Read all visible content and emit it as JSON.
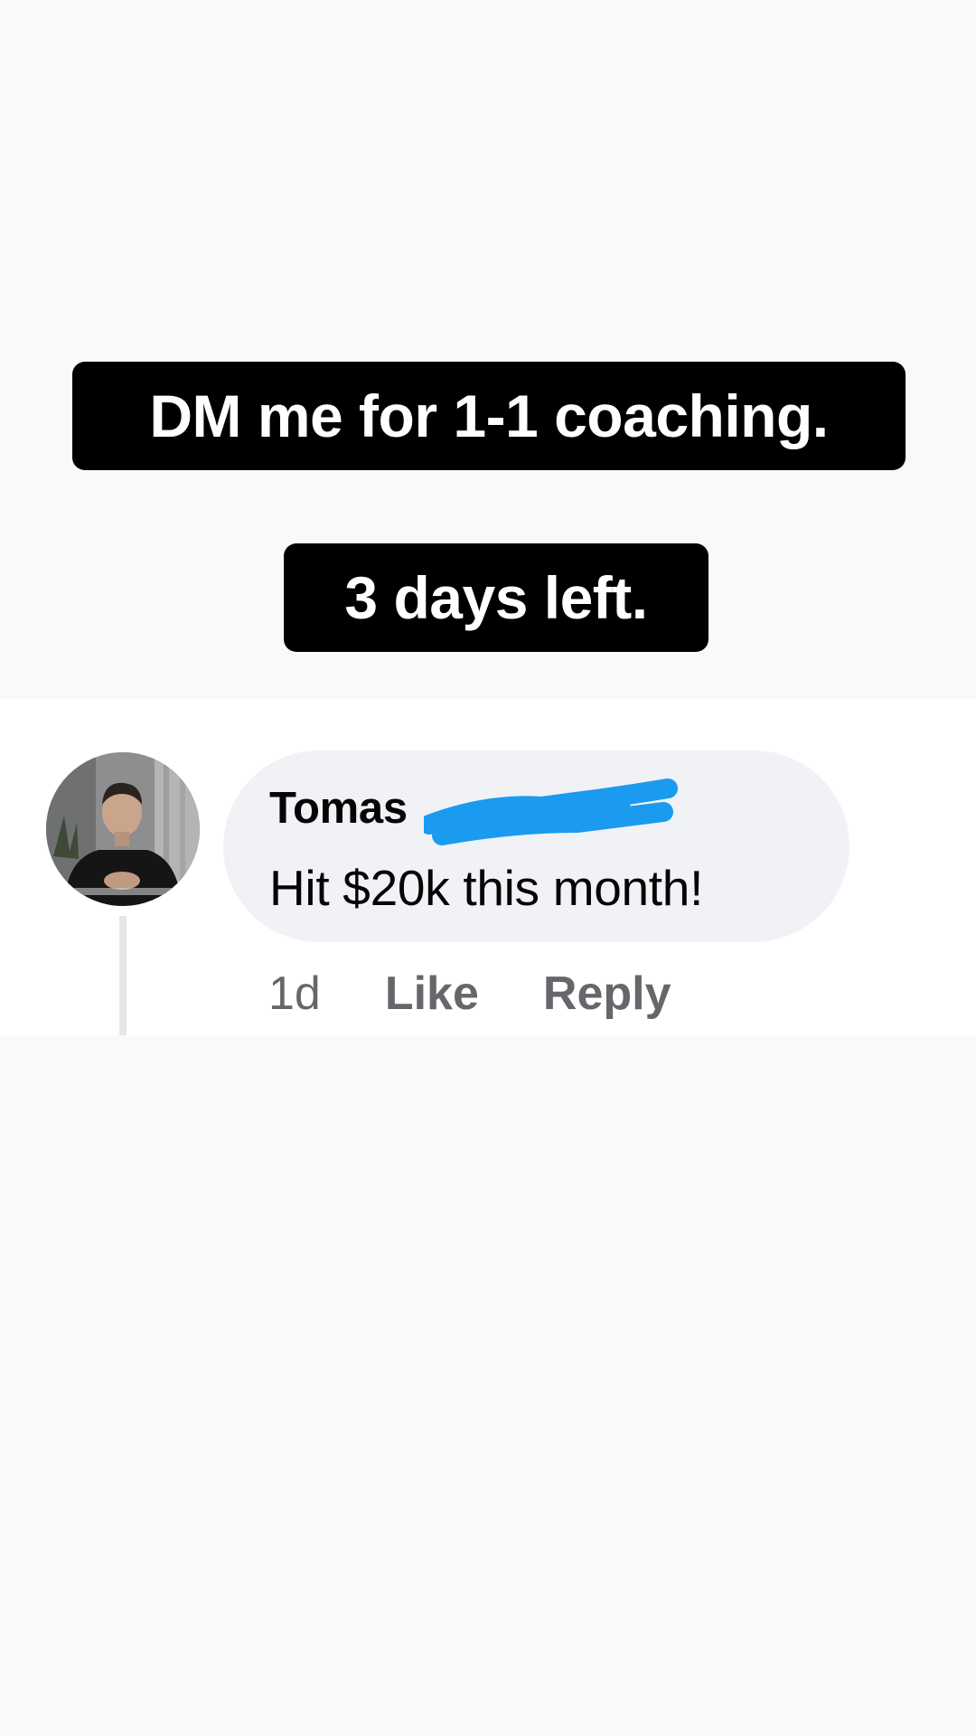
{
  "story": {
    "caption_line_1": "DM me for 1-1 coaching.",
    "caption_line_2": "3 days left."
  },
  "comment": {
    "author_name": "Tomas",
    "author_name_redacted": true,
    "text": "Hit $20k this month!",
    "timestamp": "1d",
    "like_label": "Like",
    "reply_label": "Reply"
  },
  "colors": {
    "caption_background": "#000000",
    "caption_text": "#ffffff",
    "bubble_background": "#f0f2f5",
    "redaction_scribble": "#1a9bf0",
    "action_text": "#65676b"
  }
}
